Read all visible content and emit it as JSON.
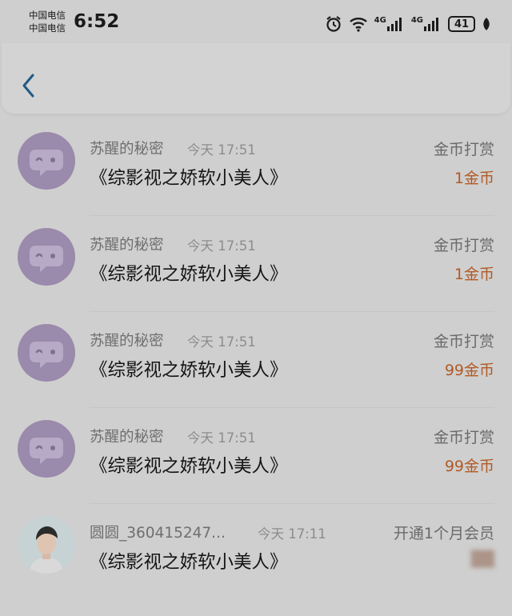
{
  "status_bar": {
    "carrier_1": "中国电信",
    "carrier_2": "中国电信",
    "time": "6:52",
    "network_1": "4G",
    "network_2": "4G",
    "battery": "41",
    "icons": [
      "alarm-icon",
      "wifi-icon",
      "cellular-signal-icon",
      "cellular-signal-icon",
      "battery-icon",
      "leaf-icon"
    ]
  },
  "header": {
    "back_icon": "chevron-left-icon"
  },
  "colors": {
    "amount": "#b15a26",
    "back": "#1e5a86",
    "avatar": "#9a8aac"
  },
  "records": [
    {
      "name": "苏醒的秘密",
      "time": "今天 17:51",
      "title": "《综影视之娇软小美人》",
      "type": "金币打赏",
      "amount": "1金币"
    },
    {
      "name": "苏醒的秘密",
      "time": "今天 17:51",
      "title": "《综影视之娇软小美人》",
      "type": "金币打赏",
      "amount": "1金币"
    },
    {
      "name": "苏醒的秘密",
      "time": "今天 17:51",
      "title": "《综影视之娇软小美人》",
      "type": "金币打赏",
      "amount": "99金币"
    },
    {
      "name": "苏醒的秘密",
      "time": "今天 17:51",
      "title": "《综影视之娇软小美人》",
      "type": "金币打赏",
      "amount": "99金币"
    },
    {
      "name": "圆圆_360415247...",
      "time": "今天 17:11",
      "title": "《综影视之娇软小美人》",
      "type": "开通1个月会员",
      "amount": ""
    }
  ]
}
